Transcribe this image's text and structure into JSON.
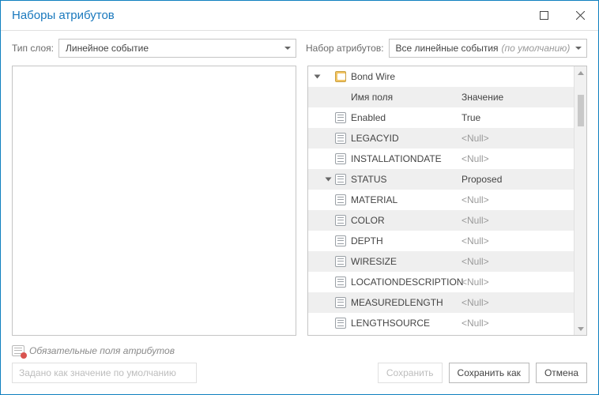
{
  "title": "Наборы атрибутов",
  "controls": {
    "layer_type_label": "Тип слоя:",
    "layer_type_value": "Линейное событие",
    "attr_set_label": "Набор атрибутов:",
    "attr_set_value": "Все линейные события",
    "attr_set_suffix": "(по умолчанию)"
  },
  "grid": {
    "group_name": "Bond Wire",
    "header_name": "Имя поля",
    "header_value": "Значение",
    "rows": [
      {
        "name": "Enabled",
        "value": "True",
        "null": false,
        "alt": false
      },
      {
        "name": "LEGACYID",
        "value": "<Null>",
        "null": true,
        "alt": true
      },
      {
        "name": "INSTALLATIONDATE",
        "value": "<Null>",
        "null": true,
        "alt": false
      },
      {
        "name": "STATUS",
        "value": "Proposed",
        "null": false,
        "alt": true,
        "expander": true
      },
      {
        "name": "MATERIAL",
        "value": "<Null>",
        "null": true,
        "alt": false
      },
      {
        "name": "COLOR",
        "value": "<Null>",
        "null": true,
        "alt": true
      },
      {
        "name": "DEPTH",
        "value": "<Null>",
        "null": true,
        "alt": false
      },
      {
        "name": "WIRESIZE",
        "value": "<Null>",
        "null": true,
        "alt": true
      },
      {
        "name": "LOCATIONDESCRIPTION",
        "value": "<Null>",
        "null": true,
        "alt": false
      },
      {
        "name": "MEASUREDLENGTH",
        "value": "<Null>",
        "null": true,
        "alt": true
      },
      {
        "name": "LENGTHSOURCE",
        "value": "<Null>",
        "null": true,
        "alt": false
      }
    ]
  },
  "footer": {
    "required_note": "Обязательные поля атрибутов",
    "set_default": "Задано как значение по умолчанию",
    "save": "Сохранить",
    "save_as": "Сохранить как",
    "cancel": "Отмена"
  }
}
